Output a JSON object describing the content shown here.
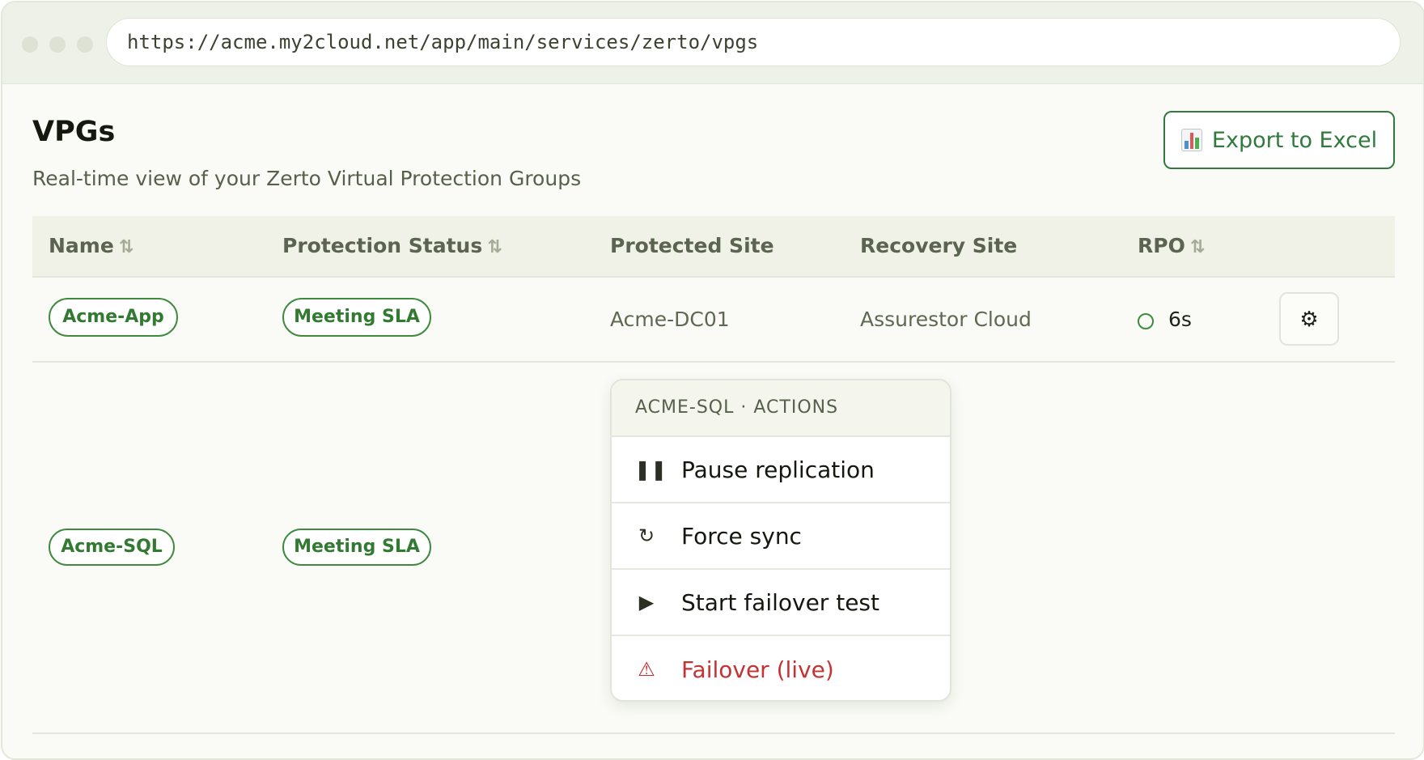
{
  "browser": {
    "url": "https://acme.my2cloud.net/app/main/services/zerto/vpgs"
  },
  "page": {
    "title": "VPGs",
    "subtitle": "Real-time view of your Zerto Virtual Protection Groups",
    "export_label": "Export to Excel"
  },
  "table": {
    "columns": {
      "name": "Name",
      "status": "Protection Status",
      "protected_site": "Protected Site",
      "recovery_site": "Recovery Site",
      "rpo": "RPO"
    },
    "rows": [
      {
        "name": "Acme-App",
        "status": "Meeting SLA",
        "protected_site": "Acme-DC01",
        "recovery_site": "Assurestor Cloud",
        "rpo": "6s"
      },
      {
        "name": "Acme-SQL",
        "status": "Meeting SLA",
        "protected_site": "",
        "recovery_site": "",
        "rpo": ""
      }
    ]
  },
  "menu": {
    "header": "ACME-SQL · ACTIONS",
    "items": [
      {
        "label": "Pause replication",
        "icon": "pause-icon"
      },
      {
        "label": "Force sync",
        "icon": "refresh-icon"
      },
      {
        "label": "Start failover test",
        "icon": "play-icon"
      },
      {
        "label": "Failover (live)",
        "icon": "warning-icon"
      }
    ]
  },
  "colors": {
    "accent": "#2f7a3c",
    "danger": "#c43333",
    "background": "#fafbf6"
  }
}
